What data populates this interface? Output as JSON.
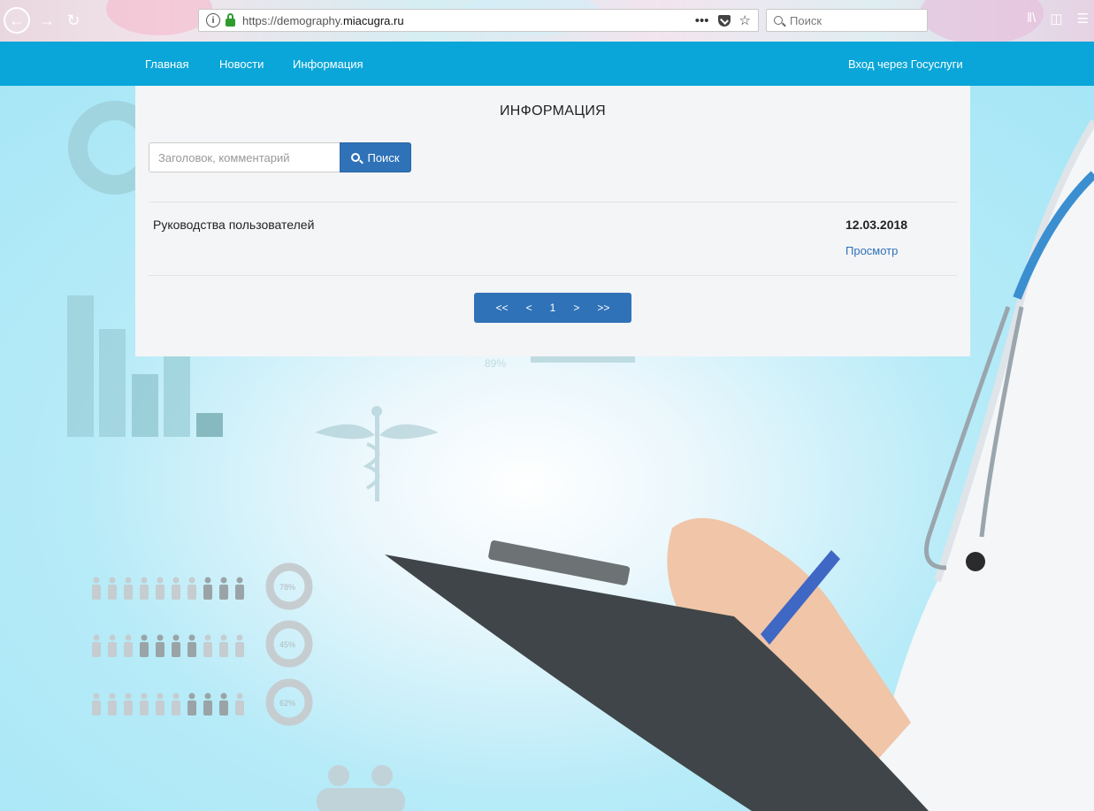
{
  "browser": {
    "url_prefix": "https://demography.",
    "url_domain": "miacugra.ru",
    "search_placeholder": "Поиск",
    "more_icon": "•••"
  },
  "nav": {
    "home": "Главная",
    "news": "Новости",
    "info": "Информация",
    "login": "Вход через Госуслуги"
  },
  "page": {
    "title": "ИНФОРМАЦИЯ",
    "search_placeholder": "Заголовок, комментарий",
    "search_button": "Поиск",
    "items": [
      {
        "title": "Руководства пользователей",
        "date": "12.03.2018",
        "action": "Просмотр"
      }
    ],
    "pager": {
      "first": "<<",
      "prev": "<",
      "current": "1",
      "next": ">",
      "last": ">>"
    }
  },
  "background": {
    "people_percents": [
      "78%",
      "45%",
      "62%"
    ],
    "stat_percent": "89%"
  },
  "colors": {
    "nav": "#0aa6d9",
    "button": "#2f72b8",
    "card": "#f4f5f7"
  }
}
